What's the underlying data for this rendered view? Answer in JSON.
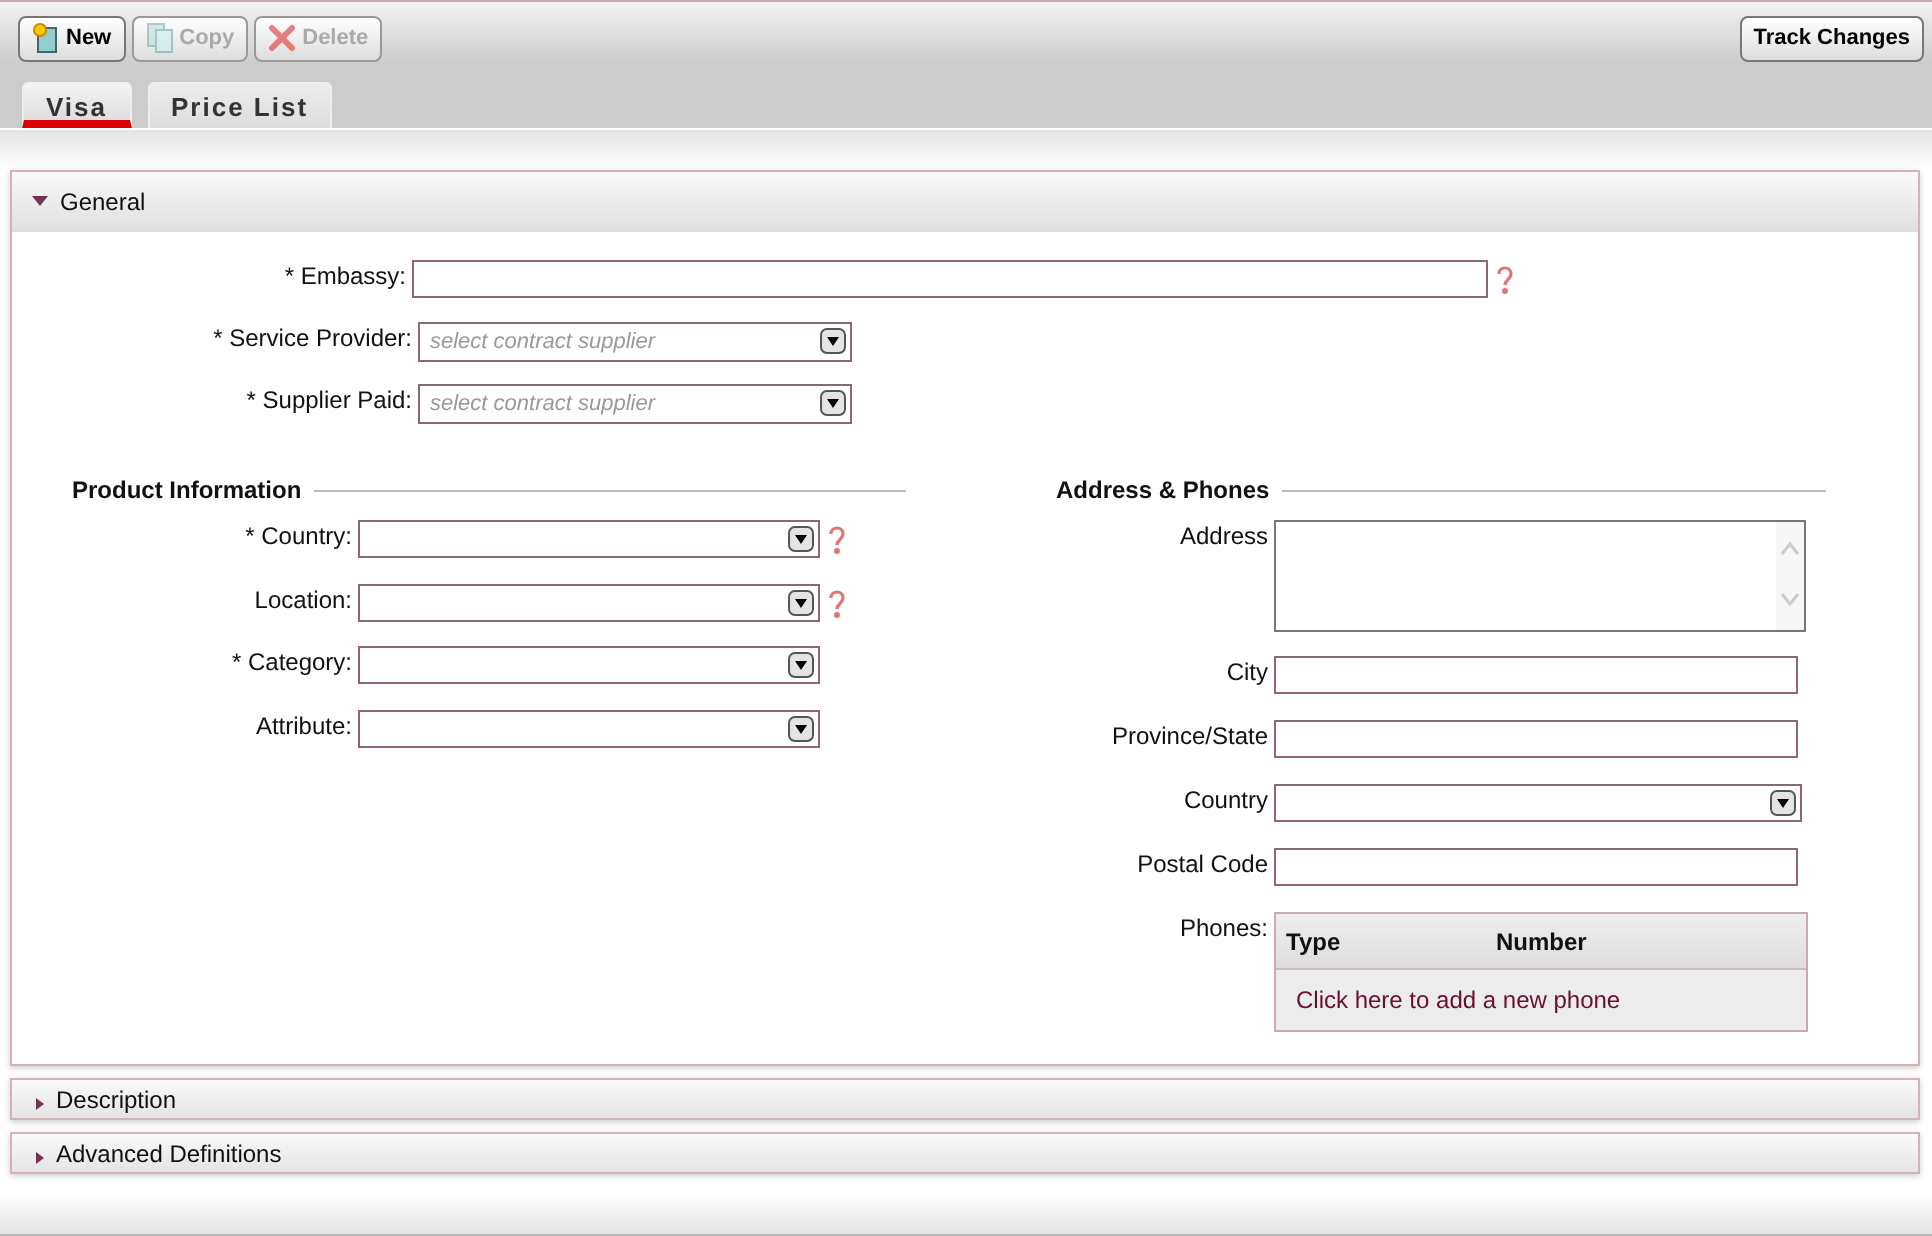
{
  "toolbar": {
    "buttons": [
      {
        "label": "New",
        "kind": "new",
        "disabled": false
      },
      {
        "label": "Copy",
        "kind": "copy",
        "disabled": true
      },
      {
        "label": "Delete",
        "kind": "delete",
        "disabled": true
      }
    ],
    "track_changes": "Track Changes"
  },
  "tabs": [
    {
      "label": "Visa",
      "selected": true
    },
    {
      "label": "Price List",
      "selected": false
    }
  ],
  "general": {
    "title": "General",
    "expanded": true,
    "top_fields": [
      {
        "label": "* Embassy:",
        "kind": "text",
        "help": true
      },
      {
        "label": "* Service Provider:",
        "kind": "select",
        "placeholder": "select contract supplier",
        "help": false
      },
      {
        "label": "* Supplier Paid:",
        "kind": "select",
        "placeholder": "select contract supplier",
        "help": false
      }
    ],
    "product_information": {
      "title": "Product Information",
      "fields": [
        {
          "label": "* Country:",
          "kind": "select",
          "help": true
        },
        {
          "label": "Location:",
          "kind": "select",
          "help": true
        },
        {
          "label": "* Category:",
          "kind": "select",
          "help": false
        },
        {
          "label": "Attribute:",
          "kind": "select",
          "help": false
        }
      ]
    },
    "address_phones": {
      "title": "Address & Phones",
      "fields": [
        {
          "label": "Address",
          "kind": "textarea"
        },
        {
          "label": "City",
          "kind": "text"
        },
        {
          "label": "Province/State",
          "kind": "text"
        },
        {
          "label": "Country",
          "kind": "select"
        },
        {
          "label": "Postal Code",
          "kind": "text"
        }
      ],
      "phones": {
        "label": "Phones:",
        "columns": [
          "Type",
          "Number"
        ],
        "add_link": "Click here to add a new phone"
      }
    }
  },
  "collapsed_sections": [
    {
      "title": "Description",
      "expanded": false
    },
    {
      "title": "Advanced Definitions",
      "expanded": false
    }
  ]
}
